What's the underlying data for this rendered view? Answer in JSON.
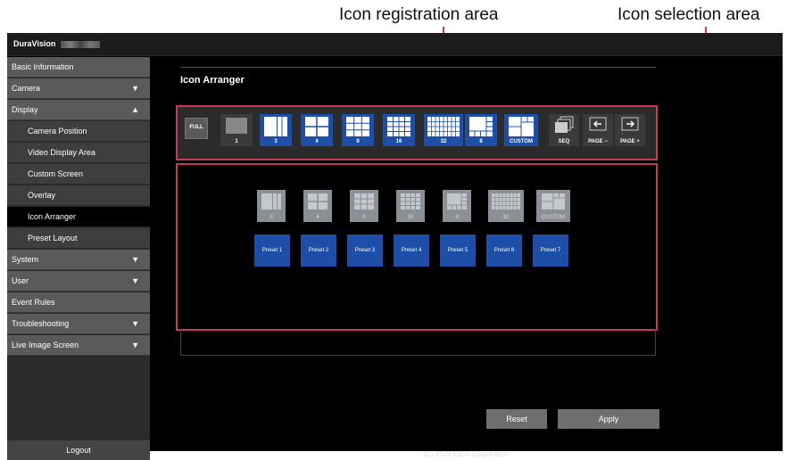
{
  "callouts": {
    "registration": "Icon registration area",
    "selection": "Icon selection area"
  },
  "app": {
    "brand": "DuraVision"
  },
  "sidebar": {
    "items": [
      {
        "label": "Basic Information",
        "arrow": ""
      },
      {
        "label": "Camera",
        "arrow": "▼"
      },
      {
        "label": "Display",
        "arrow": "▲"
      },
      {
        "label": "Camera Position",
        "arrow": ""
      },
      {
        "label": "Video Display Area",
        "arrow": ""
      },
      {
        "label": "Custom Screen",
        "arrow": ""
      },
      {
        "label": "Overlay",
        "arrow": ""
      },
      {
        "label": "Icon Arranger",
        "arrow": ""
      },
      {
        "label": "Preset Layout",
        "arrow": ""
      },
      {
        "label": "System",
        "arrow": "▼"
      },
      {
        "label": "User",
        "arrow": "▼"
      },
      {
        "label": "Event Rules",
        "arrow": ""
      },
      {
        "label": "Troubleshooting",
        "arrow": "▼"
      },
      {
        "label": "Live Image Screen",
        "arrow": "▼"
      }
    ],
    "logout": "Logout"
  },
  "main": {
    "title": "Icon Arranger",
    "registration_icons": [
      {
        "label": "FULL",
        "icon": "full-icon"
      },
      {
        "label": "1",
        "icon": "layout-1-icon"
      },
      {
        "label": "3",
        "icon": "layout-3-icon"
      },
      {
        "label": "4",
        "icon": "layout-4-icon"
      },
      {
        "label": "9",
        "icon": "layout-9-icon"
      },
      {
        "label": "16",
        "icon": "layout-16-icon"
      },
      {
        "label": "32",
        "icon": "layout-32-icon"
      },
      {
        "label": "8",
        "icon": "layout-8-icon"
      },
      {
        "label": "CUSTOM",
        "icon": "layout-custom-icon"
      },
      {
        "label": "SEQ",
        "icon": "sequence-icon"
      },
      {
        "label": "PAGE −",
        "icon": "page-prev-icon"
      },
      {
        "label": "PAGE +",
        "icon": "page-next-icon"
      }
    ],
    "selection_icons": [
      {
        "label": "3",
        "icon": "layout-3-icon"
      },
      {
        "label": "4",
        "icon": "layout-4-icon"
      },
      {
        "label": "9",
        "icon": "layout-9-icon"
      },
      {
        "label": "16",
        "icon": "layout-16-icon"
      },
      {
        "label": "8",
        "icon": "layout-8-icon"
      },
      {
        "label": "32",
        "icon": "layout-32-icon"
      },
      {
        "label": "CUSTOM",
        "icon": "layout-custom-icon"
      }
    ],
    "presets": [
      "Preset 1",
      "Preset 2",
      "Preset 3",
      "Preset 4",
      "Preset 5",
      "Preset 6",
      "Preset 7"
    ],
    "reset_label": "Reset",
    "apply_label": "Apply",
    "copyright": "(C) 2025 EIZO Corporation"
  },
  "colors": {
    "accent_blue": "#1e4fa8",
    "highlight_red": "#c8385a",
    "inactive_gray": "#8b8f96"
  }
}
